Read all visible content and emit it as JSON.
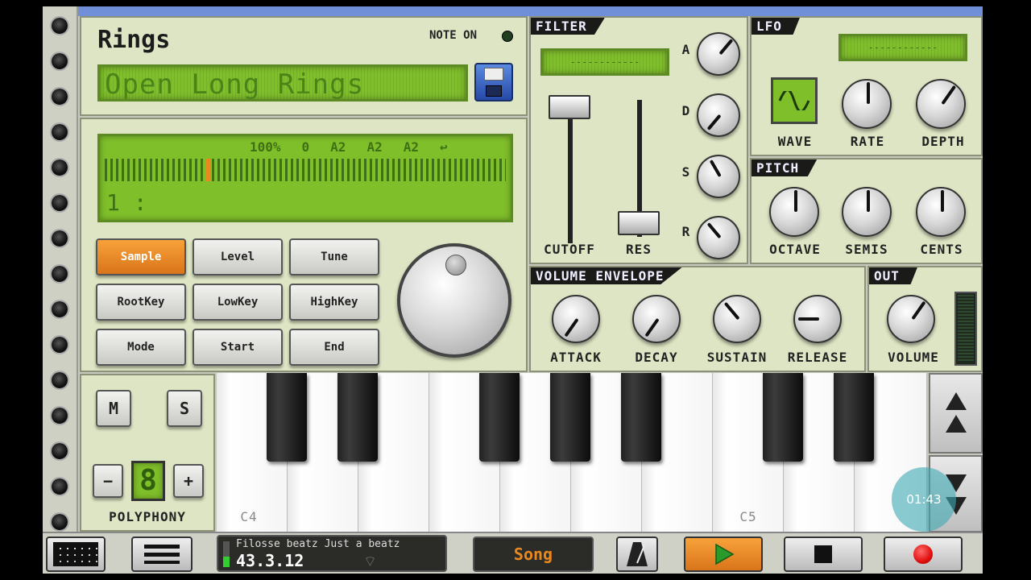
{
  "instrument": {
    "title": "Rings",
    "note_on_label": "NOTE ON",
    "preset_name": "Open Long Rings"
  },
  "sample": {
    "status": [
      "100%",
      "0",
      "A2",
      "A2",
      "A2"
    ],
    "zone_label": "1 :"
  },
  "buttons": {
    "sample": "Sample",
    "level": "Level",
    "tune": "Tune",
    "rootkey": "RootKey",
    "lowkey": "LowKey",
    "highkey": "HighKey",
    "mode": "Mode",
    "start": "Start",
    "end": "End"
  },
  "filter": {
    "title": "FILTER",
    "display": "------------",
    "adsr": [
      "A",
      "D",
      "S",
      "R"
    ],
    "cutoff_label": "CUTOFF",
    "res_label": "RES"
  },
  "lfo": {
    "title": "LFO",
    "display": "------------",
    "wave_label": "WAVE",
    "rate_label": "RATE",
    "depth_label": "DEPTH"
  },
  "pitch": {
    "title": "PITCH",
    "octave_label": "OCTAVE",
    "semis_label": "SEMIS",
    "cents_label": "CENTS"
  },
  "envelope": {
    "title": "VOLUME ENVELOPE",
    "attack_label": "ATTACK",
    "decay_label": "DECAY",
    "sustain_label": "SUSTAIN",
    "release_label": "RELEASE"
  },
  "out": {
    "title": "OUT",
    "volume_label": "VOLUME"
  },
  "voice": {
    "mute": "M",
    "solo": "S",
    "minus": "−",
    "plus": "+",
    "polyphony_value": "8",
    "polyphony_label": "POLYPHONY"
  },
  "keyboard": {
    "c4": "C4",
    "c5": "C5"
  },
  "recording_timer": "01:43",
  "transport": {
    "song_name": "Filosse beatz Just a beatz",
    "position": "43.3.12",
    "song_button": "Song"
  },
  "colors": {
    "lcd": "#7fbf2a",
    "panel": "#dde5c4",
    "accent_orange": "#e8881f",
    "play_green": "#2a9a2a",
    "record_red": "#e01010"
  }
}
